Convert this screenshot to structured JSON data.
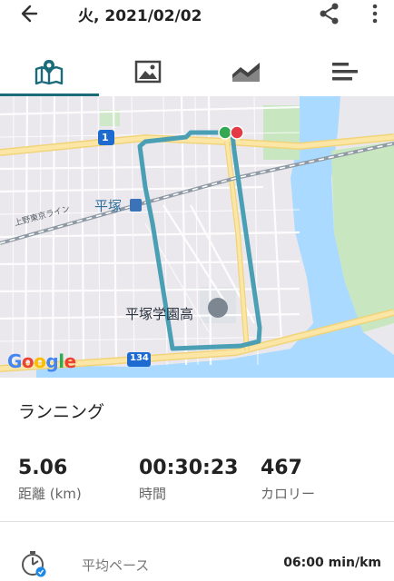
{
  "appbar": {
    "title": "火, 2021/02/02",
    "back_icon": "arrow-back-icon",
    "share_icon": "share-icon",
    "more_icon": "more-vert-icon"
  },
  "tabs": [
    {
      "icon": "map-pin-icon",
      "active": true
    },
    {
      "icon": "image-icon",
      "active": false
    },
    {
      "icon": "area-chart-icon",
      "active": false
    },
    {
      "icon": "list-bars-icon",
      "active": false
    }
  ],
  "map": {
    "station_label": "平塚",
    "school_label": "平塚学園高",
    "rail_label": "上野東京ライン",
    "route1_shield": "1",
    "route134_shield": "134",
    "google_logo": [
      "G",
      "o",
      "o",
      "g",
      "l",
      "e"
    ],
    "route_color": "#4a9fb5",
    "start_color": "#34a853",
    "end_color": "#e53945"
  },
  "activity": {
    "type": "ランニング"
  },
  "stats": [
    {
      "value": "5.06",
      "label": "距離 (km)"
    },
    {
      "value": "00:30:23",
      "label": "時間"
    },
    {
      "value": "467",
      "label": "カロリー"
    }
  ],
  "pace": {
    "label": "平均ペース",
    "value": "06:00 min/km",
    "icon": "stopwatch-icon"
  },
  "colors": {
    "accent": "#1b6b7a"
  }
}
